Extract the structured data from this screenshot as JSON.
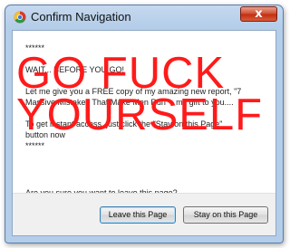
{
  "window": {
    "title": "Confirm Navigation",
    "close_label": "x"
  },
  "message": {
    "lines": [
      "******",
      "",
      "WAIT... BEFORE YOU GO!",
      "",
      "Let me give you a FREE copy of my amazing new report, \"7",
      "Massive Mistakes That Make Men Run\" - my gift to you....",
      "",
      "To get instant access, just click the \"Stay on this Page\"",
      "button now",
      "******"
    ]
  },
  "overlay": {
    "lines": [
      "GO FUCK",
      "YOURSELF"
    ],
    "color": "#ff1a1a"
  },
  "question": "Are you sure you want to leave this page?",
  "buttons": {
    "leave": "Leave this Page",
    "stay": "Stay on this Page"
  },
  "icons": {
    "app": "chrome-icon",
    "close": "close-icon"
  }
}
